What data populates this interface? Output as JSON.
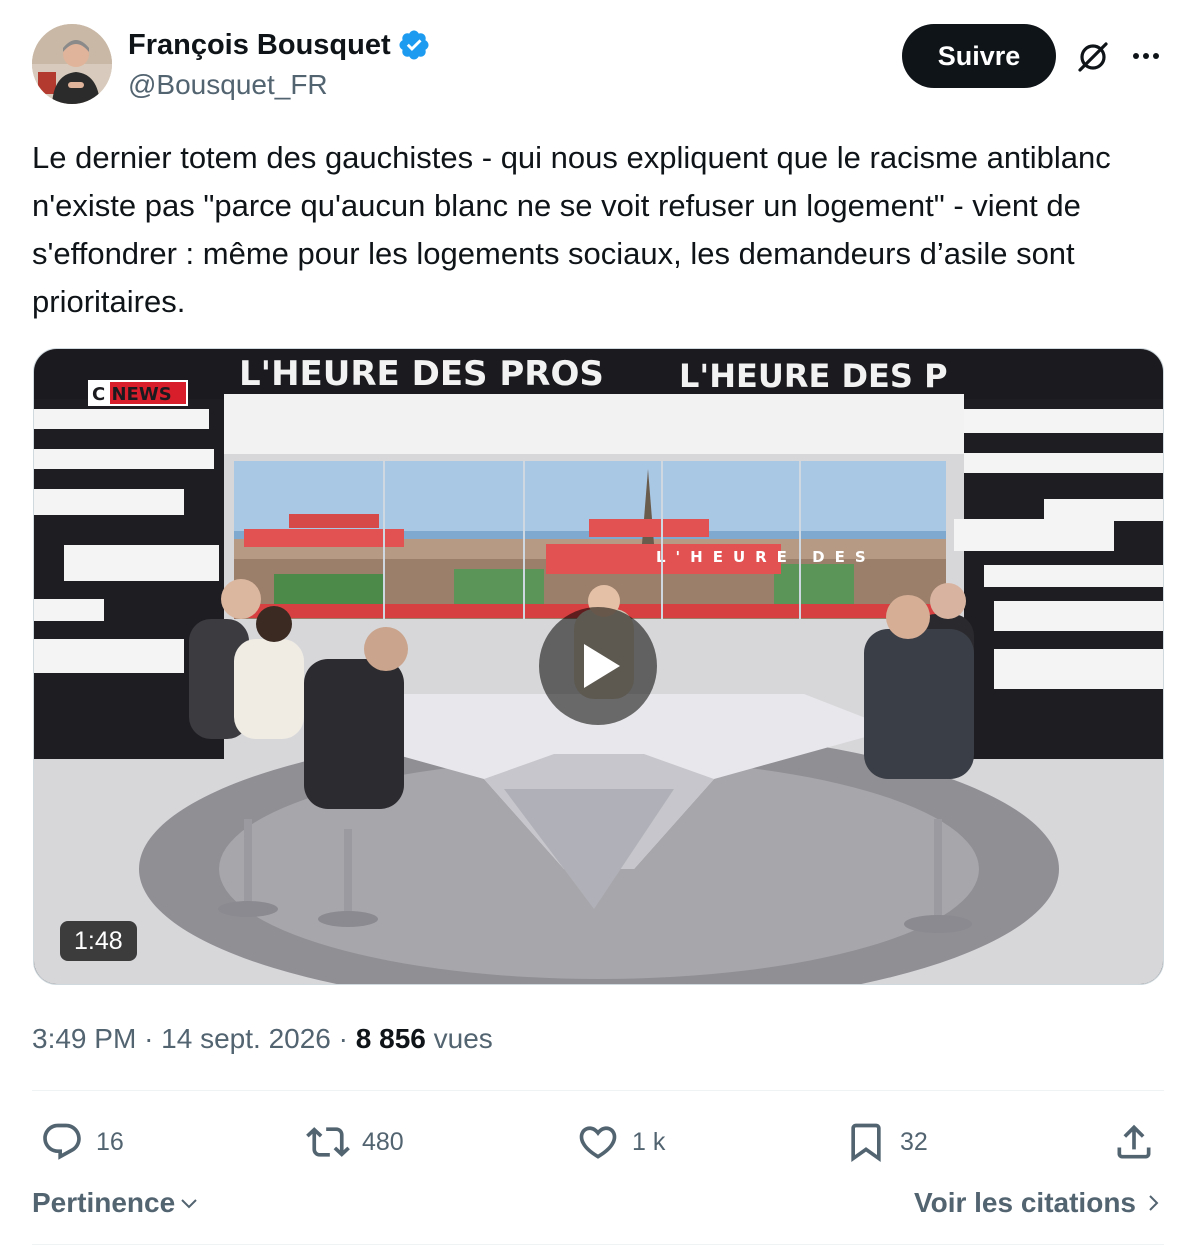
{
  "author": {
    "display_name": "François Bousquet",
    "handle": "@Bousquet_FR",
    "verified": true
  },
  "follow_label": "Suivre",
  "tweet_text": "Le dernier totem des gauchistes - qui nous expliquent que le racisme antiblanc n'existe pas \"parce qu'aucun blanc ne se voit refuser un logement\" - vient de s'effondrer : même pour les logements sociaux, les demandeurs d’asile sont prioritaires.",
  "media": {
    "duration": "1:48",
    "channel_logo": "C NEWS",
    "banner_left": "L'HEURE DES PROS",
    "banner_right": "L'HEURE DES P",
    "screen_text": "L'HEURE DES"
  },
  "meta": {
    "time": "3:49 PM",
    "date": "14 sept. 2026",
    "views_count": "8 856",
    "views_label": "vues",
    "sep": "·"
  },
  "actions": {
    "replies": "16",
    "reposts": "480",
    "likes": "1 k",
    "bookmarks": "32"
  },
  "footer": {
    "sort_label": "Pertinence",
    "quotes_label": "Voir les citations"
  },
  "colors": {
    "accent_dark": "#0f1419",
    "secondary": "#536471",
    "verified_blue": "#1d9bf0",
    "divider": "#eff3f4"
  }
}
